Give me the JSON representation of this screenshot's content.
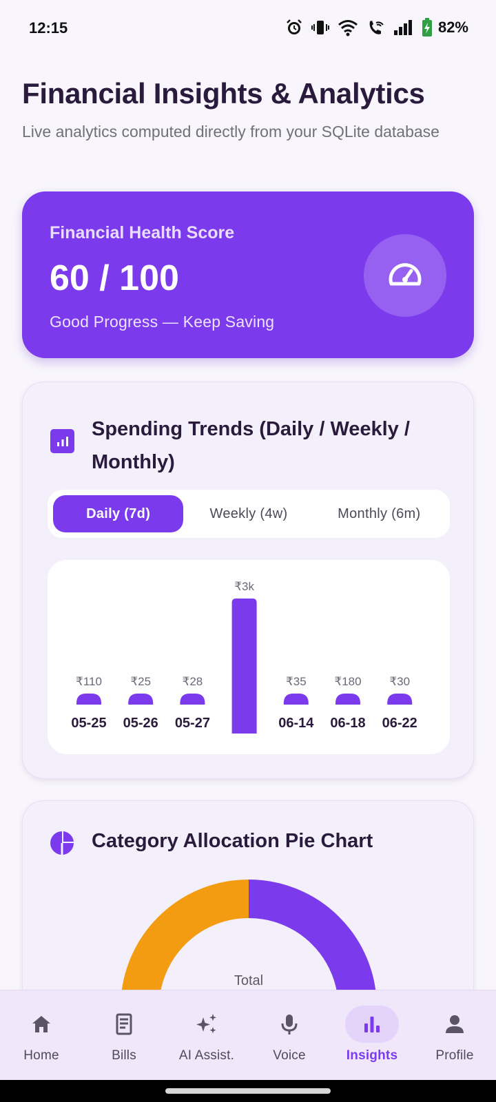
{
  "status_bar": {
    "time": "12:15",
    "battery": "82%",
    "icons": [
      "alarm-icon",
      "vibrate-icon",
      "wifi-icon",
      "wifi-call-icon",
      "signal-icon",
      "battery-charging-icon"
    ]
  },
  "header": {
    "title": "Financial Insights & Analytics",
    "subtitle": "Live analytics computed directly from your SQLite database"
  },
  "health": {
    "label": "Financial Health Score",
    "score": "60 / 100",
    "status": "Good Progress — Keep Saving",
    "icon": "speedometer-icon"
  },
  "trends": {
    "icon": "bar-chart-icon",
    "title": "Spending Trends (Daily / Weekly / Monthly)",
    "tabs": [
      {
        "label": "Daily (7d)",
        "active": true
      },
      {
        "label": "Weekly (4w)",
        "active": false
      },
      {
        "label": "Monthly (6m)",
        "active": false
      }
    ]
  },
  "chart_data": {
    "type": "bar",
    "categories": [
      "05-25",
      "05-26",
      "05-27",
      "",
      "06-14",
      "06-18",
      "06-22"
    ],
    "values": [
      110,
      25,
      28,
      3000,
      35,
      180,
      30
    ],
    "data_labels": [
      "₹110",
      "₹25",
      "₹28",
      "₹3k",
      "₹35",
      "₹180",
      "₹30"
    ],
    "color": "#7c3aed",
    "title": "",
    "xlabel": "",
    "ylabel": ""
  },
  "category_pie": {
    "icon": "pie-chart-icon",
    "title": "Category Allocation Pie Chart",
    "center_label": "Total",
    "segments": [
      {
        "color": "#7c3aed",
        "fraction": 0.5
      },
      {
        "color": "#f39c12",
        "fraction": 0.5
      }
    ]
  },
  "nav": {
    "items": [
      {
        "label": "Home",
        "icon": "home-icon",
        "active": false
      },
      {
        "label": "Bills",
        "icon": "receipt-icon",
        "active": false
      },
      {
        "label": "AI Assist.",
        "icon": "sparkle-icon",
        "active": false
      },
      {
        "label": "Voice",
        "icon": "microphone-icon",
        "active": false
      },
      {
        "label": "Insights",
        "icon": "bar-chart-icon",
        "active": true
      },
      {
        "label": "Profile",
        "icon": "person-icon",
        "active": false
      }
    ]
  },
  "colors": {
    "accent": "#7c3aed",
    "orange": "#f39c12",
    "background": "#f8f6fc"
  }
}
